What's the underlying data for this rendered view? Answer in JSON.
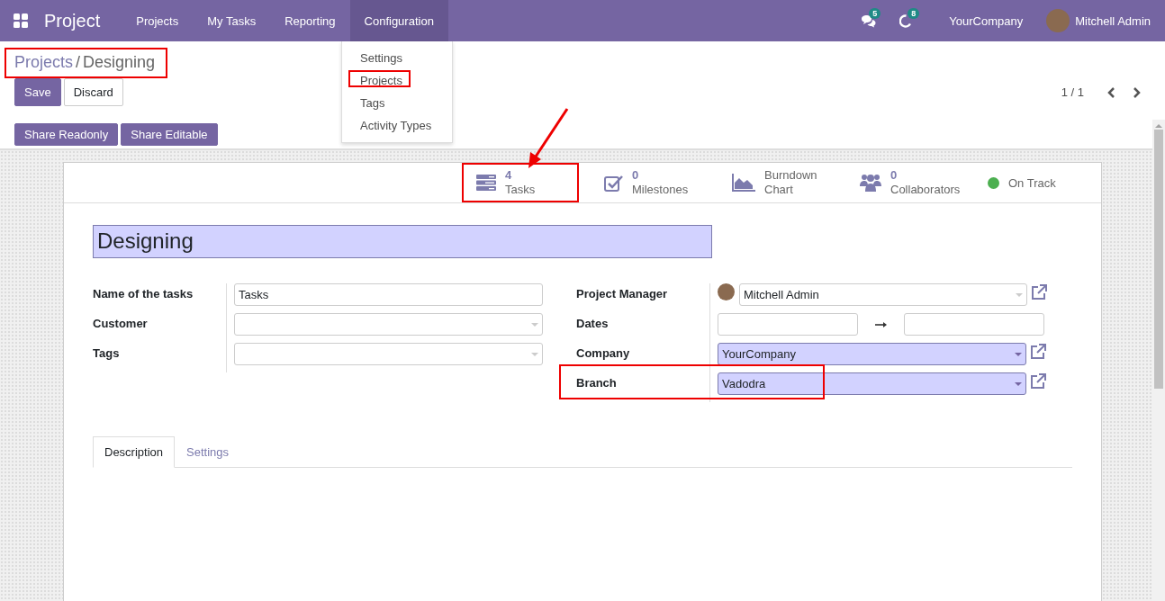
{
  "navbar": {
    "app_name": "Project",
    "menu": [
      {
        "label": "Projects",
        "open": false
      },
      {
        "label": "My Tasks",
        "open": false
      },
      {
        "label": "Reporting",
        "open": false
      },
      {
        "label": "Configuration",
        "open": true
      }
    ],
    "messages_count": "5",
    "activities_count": "8",
    "company": "YourCompany",
    "user": "Mitchell Admin"
  },
  "dropdown": {
    "items": [
      {
        "label": "Settings",
        "highlighted": false
      },
      {
        "label": "Projects",
        "highlighted": true
      },
      {
        "label": "Tags",
        "highlighted": false
      },
      {
        "label": "Activity Types",
        "highlighted": false
      }
    ]
  },
  "breadcrumb": {
    "parent": "Projects",
    "separator": "/",
    "current": "Designing",
    "highlighted": true
  },
  "buttons": [
    "Save",
    "Discard"
  ],
  "pager": "1 / 1",
  "share_buttons": [
    "Share Readonly",
    "Share Editable"
  ],
  "stat_buttons": [
    {
      "kind": "tasks",
      "value": "4",
      "label": "Tasks",
      "highlighted": true,
      "pointed": true
    },
    {
      "kind": "milestones",
      "value": "0",
      "label": "Milestones",
      "highlighted": false,
      "pointed": false
    },
    {
      "kind": "burndown",
      "label": "Burndown Chart",
      "highlighted": false,
      "pointed": false
    },
    {
      "kind": "collaborators",
      "value": "0",
      "label": "Collaborators",
      "highlighted": false,
      "pointed": false
    },
    {
      "kind": "status",
      "label": "On Track",
      "color": "#4caf50",
      "highlighted": false,
      "pointed": false
    }
  ],
  "title": "Designing",
  "left_fields": [
    {
      "label": "Name of the tasks",
      "kind": "text",
      "value": "Tasks",
      "highlighted": false
    },
    {
      "label": "Customer",
      "kind": "select",
      "required": false,
      "external_link": false,
      "highlighted": false
    },
    {
      "label": "Tags",
      "kind": "select",
      "required": false,
      "external_link": false,
      "highlighted": false
    }
  ],
  "right_fields": [
    {
      "label": "Project Manager",
      "kind": "user",
      "value": "Mitchell Admin",
      "required": false,
      "external_link": true,
      "highlighted": false
    },
    {
      "label": "Dates",
      "kind": "daterange",
      "highlighted": false
    },
    {
      "label": "Company",
      "kind": "select",
      "value": "YourCompany",
      "required": true,
      "external_link": true,
      "highlighted": false
    },
    {
      "label": "Branch",
      "kind": "select",
      "value": "Vadodra",
      "required": true,
      "external_link": true,
      "highlighted": true
    }
  ],
  "tabs": [
    {
      "label": "Description",
      "selected": true
    },
    {
      "label": "Settings",
      "selected": false
    }
  ]
}
